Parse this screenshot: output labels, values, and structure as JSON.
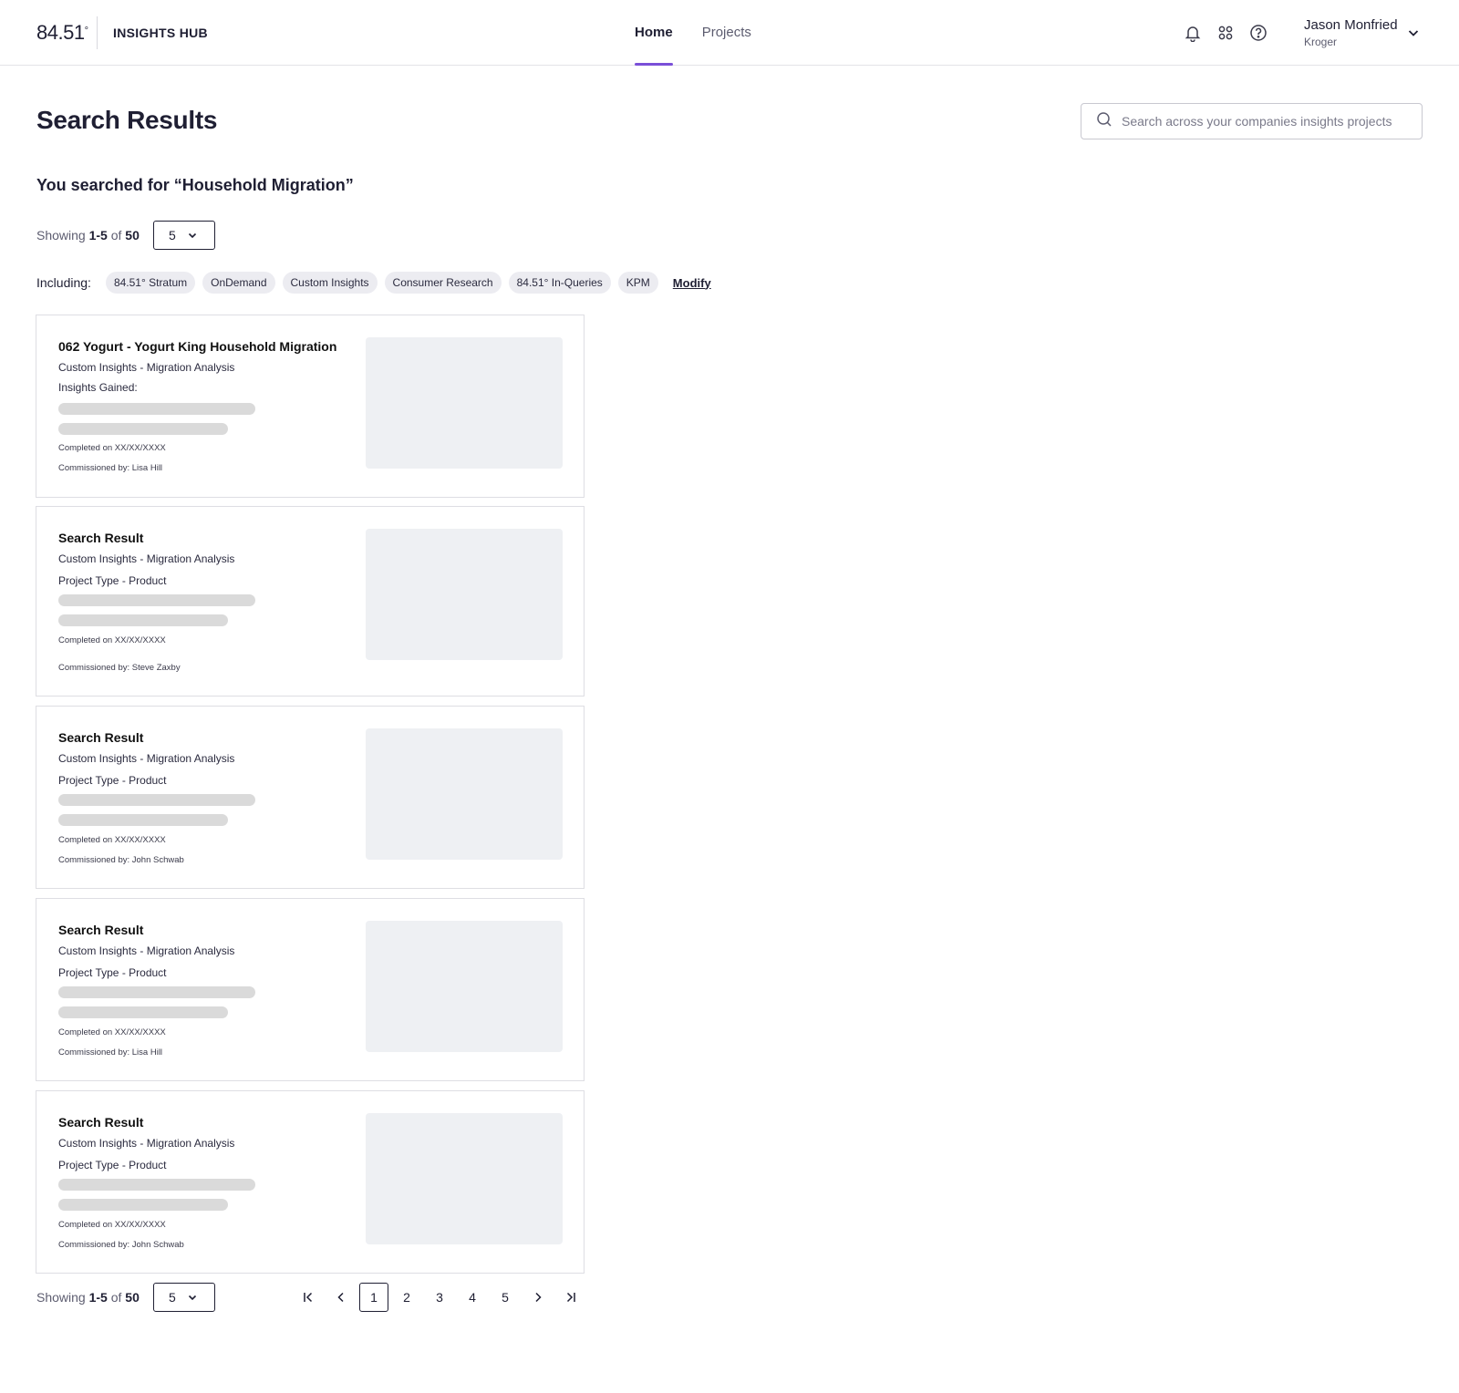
{
  "header": {
    "logo_text": "84.51",
    "logo_degree": "°",
    "product_name": "INSIGHTS HUB",
    "nav": [
      {
        "label": "Home",
        "active": true
      },
      {
        "label": "Projects",
        "active": false
      }
    ],
    "icons": [
      "bell-icon",
      "apps-grid-icon",
      "help-icon"
    ],
    "user": {
      "name": "Jason Monfried",
      "org": "Kroger"
    }
  },
  "page": {
    "title": "Search Results",
    "search_placeholder": "Search across your companies insights projects",
    "query_text": "You searched for “Household Migration”"
  },
  "results_summary": {
    "showing_label": "Showing",
    "range": "1-5",
    "of_label": "of",
    "total": "50",
    "page_size": "5"
  },
  "filters": {
    "label": "Including:",
    "chips": [
      "84.51° Stratum",
      "OnDemand",
      "Custom Insights",
      "Consumer Research",
      "84.51° In-Queries",
      "KPM"
    ],
    "modify_label": "Modify"
  },
  "results": [
    {
      "title": "062 Yogurt - Yogurt King Household Migration",
      "subtitle": "Custom Insights - Migration Analysis",
      "detail": "Insights Gained:",
      "completed": "Completed on XX/XX/XXXX",
      "commissioned": "Commissioned by: Lisa Hill"
    },
    {
      "title": "Search Result",
      "subtitle": "Custom Insights - Migration Analysis",
      "detail": "Project Type - Product",
      "completed": "Completed on XX/XX/XXXX",
      "commissioned": "Commissioned by: Steve Zaxby"
    },
    {
      "title": "Search Result",
      "subtitle": "Custom Insights - Migration Analysis",
      "detail": "Project Type - Product",
      "completed": "Completed on XX/XX/XXXX",
      "commissioned": "Commissioned by: John Schwab"
    },
    {
      "title": "Search Result",
      "subtitle": "Custom Insights - Migration Analysis",
      "detail": "Project Type - Product",
      "completed": "Completed on XX/XX/XXXX",
      "commissioned": "Commissioned by: Lisa Hill"
    },
    {
      "title": "Search Result",
      "subtitle": "Custom Insights - Migration Analysis",
      "detail": "Project Type - Product",
      "completed": "Completed on XX/XX/XXXX",
      "commissioned": "Commissioned by: John Schwab"
    }
  ],
  "pagination": {
    "pages": [
      "1",
      "2",
      "3",
      "4",
      "5"
    ],
    "current": "1",
    "icons": [
      "first-page-icon",
      "prev-page-icon",
      "next-page-icon",
      "last-page-icon"
    ]
  },
  "colors": {
    "accent": "#7a4fd8",
    "text": "#1f1f33",
    "muted": "#5d5d70",
    "chip_bg": "#ececf1",
    "skeleton": "#dadada",
    "thumb_bg": "#eef0f3"
  }
}
